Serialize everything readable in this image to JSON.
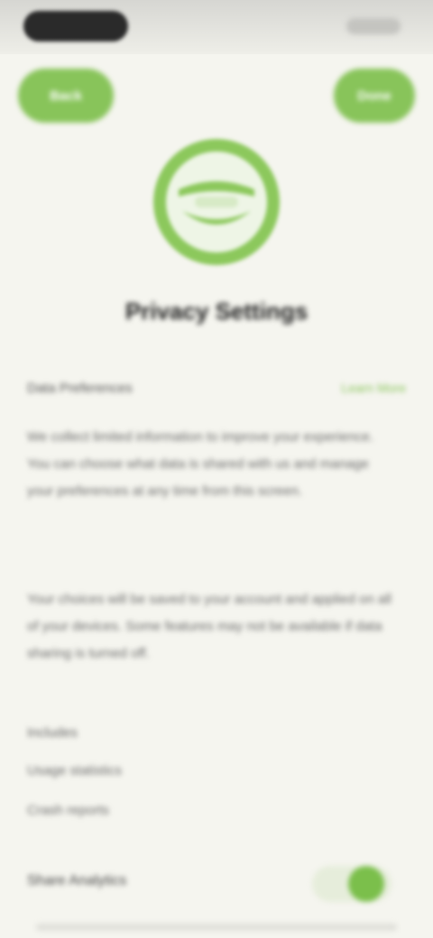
{
  "header": {
    "back_label": "Back",
    "action_label": "Done"
  },
  "logo": {
    "icon": "leaf-logo-icon"
  },
  "page": {
    "title": "Privacy Settings"
  },
  "section": {
    "label": "Data Preferences",
    "link": "Learn More"
  },
  "paragraphs": [
    "We collect limited information to improve your experience. You can choose what data is shared with us and manage your preferences at any time from this screen.",
    "Your choices will be saved to your account and applied on all of your devices. Some features may not be available if data sharing is turned off."
  ],
  "list": {
    "label": "Includes",
    "items": [
      "Usage statistics",
      "Crash reports"
    ]
  },
  "toggle": {
    "label": "Share Analytics"
  },
  "colors": {
    "accent": "#88c45a",
    "background": "#f5f5ef"
  }
}
